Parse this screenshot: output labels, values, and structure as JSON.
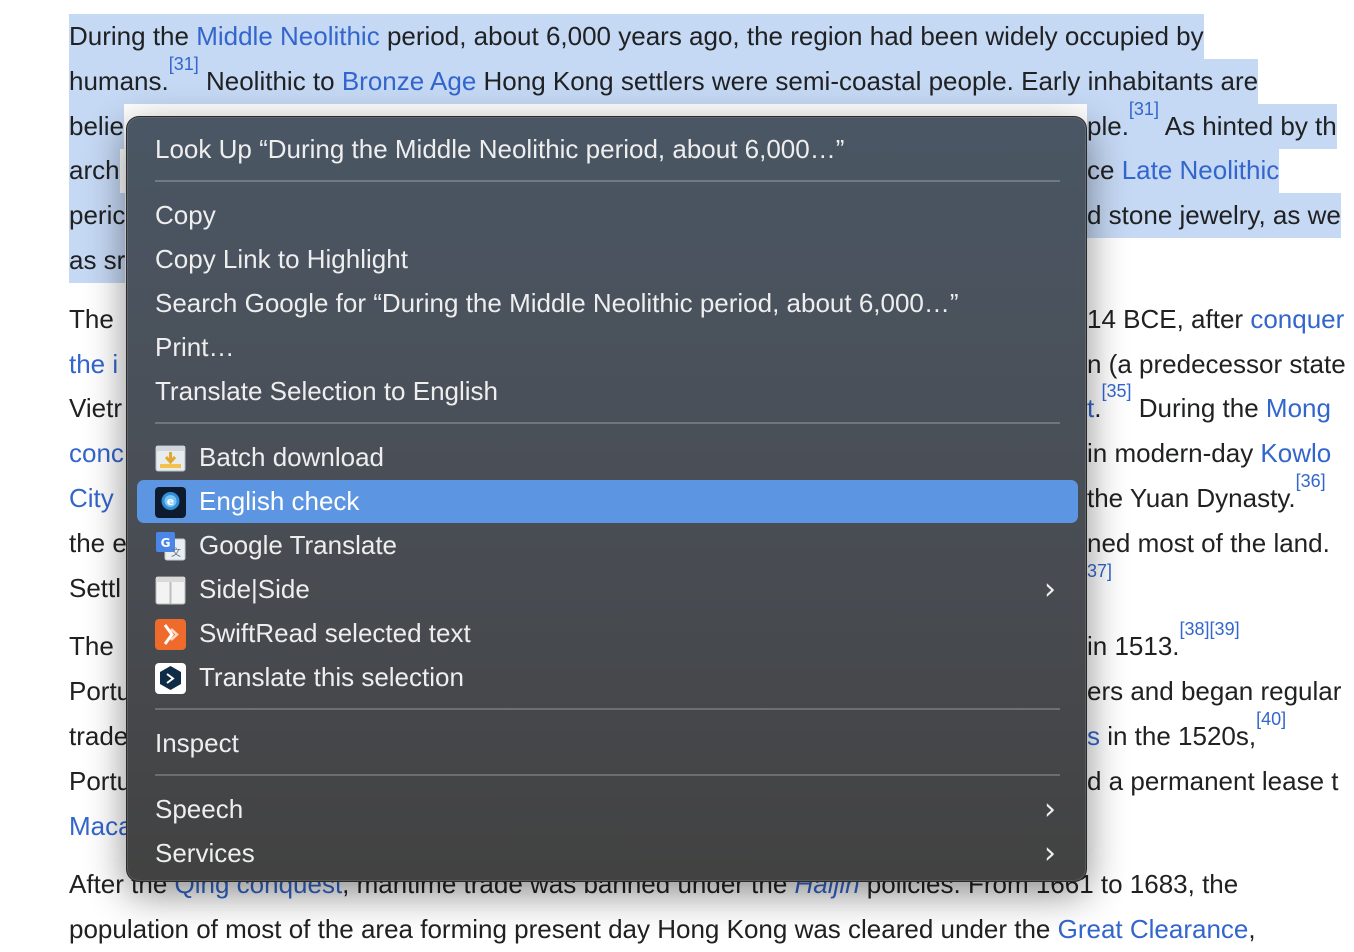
{
  "article": {
    "lines": [
      {
        "parts": [
          {
            "t": "During the "
          },
          {
            "t": "Middle Neolithic",
            "link": true
          },
          {
            "t": " period, about 6,000 years ago, the region had been widely occupied by"
          }
        ],
        "sel": true
      },
      {
        "parts": [
          {
            "t": "humans."
          },
          {
            "t": "[31]",
            "sup": true
          },
          {
            "t": " Neolithic to "
          },
          {
            "t": "Bronze Age",
            "link": true
          },
          {
            "t": " Hong Kong settlers were semi-coastal people. Early inhabitants are"
          }
        ],
        "sel": true
      },
      {
        "parts": [
          {
            "t": "belie"
          }
        ],
        "right": [
          {
            "t": "ple."
          },
          {
            "t": "[31]",
            "sup": true
          },
          {
            "t": " As hinted by th"
          }
        ],
        "sel": true
      },
      {
        "parts": [
          {
            "t": "arch"
          }
        ],
        "right": [
          {
            "t": "ce "
          },
          {
            "t": "Late Neolithic",
            "link": true
          }
        ],
        "sel": true
      },
      {
        "parts": [
          {
            "t": "peric"
          }
        ],
        "right": [
          {
            "t": "d stone jewelry, as we"
          }
        ],
        "sel": true
      },
      {
        "parts": [
          {
            "t": "as sr"
          }
        ],
        "right": [],
        "sel": true
      },
      {
        "parts": [
          {
            "t": "The"
          }
        ],
        "right": [
          {
            "t": "14 BCE, after "
          },
          {
            "t": "conquer",
            "link": true
          }
        ]
      },
      {
        "parts": [
          {
            "t": "the i",
            "link": true
          }
        ],
        "right": [
          {
            "t": "n (a predecessor state"
          }
        ]
      },
      {
        "parts": [
          {
            "t": "Vietr"
          }
        ],
        "right": [
          {
            "t": "t",
            "link": true
          },
          {
            "t": "."
          },
          {
            "t": "[35]",
            "sup": true
          },
          {
            "t": " During the "
          },
          {
            "t": "Mong",
            "link": true
          }
        ]
      },
      {
        "parts": [
          {
            "t": "conc",
            "link": true
          }
        ],
        "right": [
          {
            "t": " in modern-day "
          },
          {
            "t": "Kowlo",
            "link": true
          }
        ]
      },
      {
        "parts": [
          {
            "t": "City",
            "link": true
          }
        ],
        "right": [
          {
            "t": " the Yuan Dynasty."
          },
          {
            "t": "[36]",
            "sup": true
          }
        ]
      },
      {
        "parts": [
          {
            "t": "the e"
          }
        ],
        "right": [
          {
            "t": "ned most of the land."
          }
        ]
      },
      {
        "parts": [
          {
            "t": "Settl"
          }
        ],
        "right": [
          {
            "t": "37]",
            "sup": true
          }
        ]
      },
      {
        "parts": [
          {
            "t": "The"
          }
        ],
        "right": [
          {
            "t": "in 1513."
          },
          {
            "t": "[38][39]",
            "sup": true
          }
        ]
      },
      {
        "parts": [
          {
            "t": "Portu"
          }
        ],
        "right": [
          {
            "t": "ers and began regular"
          }
        ]
      },
      {
        "parts": [
          {
            "t": "trade"
          }
        ],
        "right": [
          {
            "t": "s",
            "link": true
          },
          {
            "t": " in the 1520s,"
          },
          {
            "t": "[40]",
            "sup": true
          }
        ]
      },
      {
        "parts": [
          {
            "t": "Portu"
          }
        ],
        "right": [
          {
            "t": "d a permanent lease t"
          }
        ]
      },
      {
        "parts": [
          {
            "t": "Maca",
            "link": true
          }
        ],
        "right": []
      },
      {
        "parts": [
          {
            "t": "After the "
          },
          {
            "t": "Qing conquest",
            "link": true
          },
          {
            "t": ", maritime trade was banned under the "
          },
          {
            "t": "Haijin",
            "link": true,
            "italic": true
          },
          {
            "t": " policies. From 1661 to 1683, the"
          }
        ]
      },
      {
        "parts": [
          {
            "t": "population of most of the area forming present day Hong Kong was cleared under the "
          },
          {
            "t": "Great Clearance",
            "link": true
          },
          {
            "t": ","
          }
        ]
      }
    ]
  },
  "menu": {
    "lookup": "Look Up “During the Middle Neolithic period, about 6,000…”",
    "copy": "Copy",
    "copy_link": "Copy Link to Highlight",
    "search_google": "Search Google for “During the Middle Neolithic period, about 6,000…”",
    "print": "Print…",
    "translate_selection": "Translate Selection to English",
    "batch_download": "Batch download",
    "english_check": "English check",
    "google_translate": "Google Translate",
    "side_side": "Side|Side",
    "swiftread": "SwiftRead selected text",
    "translate_this": "Translate this selection",
    "inspect": "Inspect",
    "speech": "Speech",
    "services": "Services",
    "icons": {
      "batch_download": "batch-download-icon",
      "english_check": "english-check-icon",
      "google_translate": "google-translate-icon",
      "side_side": "side-side-icon",
      "swiftread": "swiftread-icon",
      "translate_this": "deepl-icon",
      "submenu": "chevron-right-icon"
    },
    "highlight_color": "#5c95e1"
  }
}
